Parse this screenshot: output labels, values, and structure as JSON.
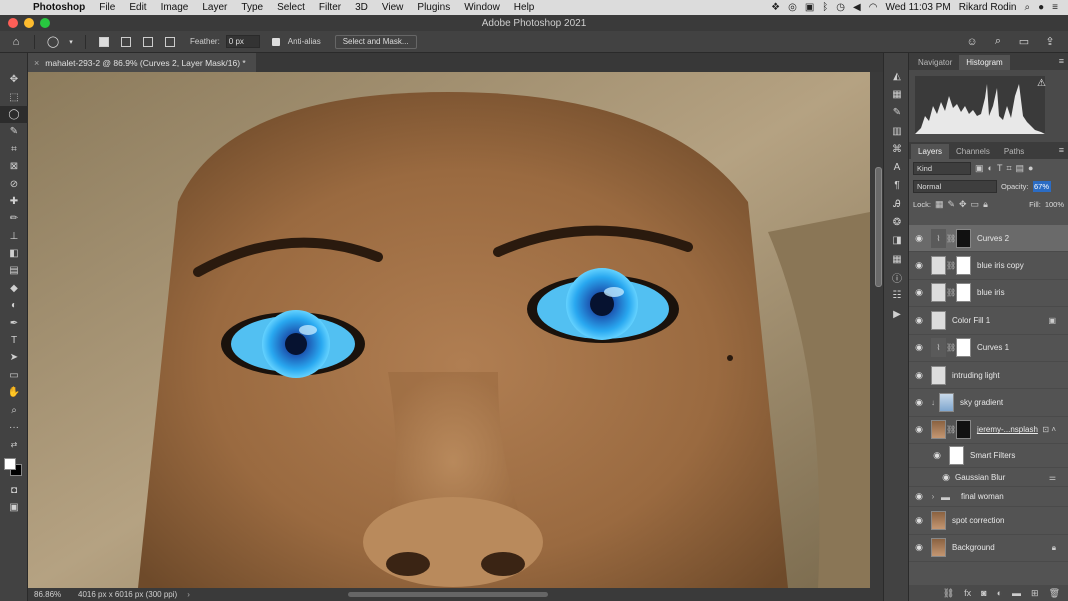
{
  "menubar": {
    "app": "Photoshop",
    "items": [
      "File",
      "Edit",
      "Image",
      "Layer",
      "Type",
      "Select",
      "Filter",
      "3D",
      "View",
      "Plugins",
      "Window",
      "Help"
    ],
    "clock": "Wed 11:03 PM",
    "user": "Rikard Rodin"
  },
  "window": {
    "title": "Adobe Photoshop 2021"
  },
  "options": {
    "feather_label": "Feather:",
    "feather_value": "0 px",
    "antialias_label": "Anti-alias",
    "select_mask_label": "Select and Mask..."
  },
  "document": {
    "tab_title": "mahalet-293-2 @ 86.9% (Curves 2, Layer Mask/16) *",
    "zoom": "86.86%",
    "dimensions": "4016 px x 6016 px (300 ppi)"
  },
  "histogram_panel": {
    "tabs": [
      "Navigator",
      "Histogram"
    ],
    "active_tab": "Histogram"
  },
  "layers_panel": {
    "tabs": [
      "Layers",
      "Channels",
      "Paths"
    ],
    "active_tab": "Layers",
    "filter_kind": "Kind",
    "blend_mode": "Normal",
    "opacity_label": "Opacity:",
    "opacity_value": "67%",
    "lock_label": "Lock:",
    "fill_label": "Fill:",
    "fill_value": "100%",
    "layers": [
      {
        "name": "Curves 2",
        "selected": true
      },
      {
        "name": "blue iris copy"
      },
      {
        "name": "blue iris"
      },
      {
        "name": "Color Fill 1"
      },
      {
        "name": "Curves 1"
      },
      {
        "name": "intruding light"
      },
      {
        "name": "sky gradient"
      },
      {
        "name": "jeremy-...nsplash"
      },
      {
        "name": "Smart Filters"
      },
      {
        "name": "Gaussian Blur"
      },
      {
        "name": "final woman"
      },
      {
        "name": "spot correction"
      },
      {
        "name": "Background"
      }
    ]
  },
  "colors": {
    "accent": "#2b6cc4",
    "iris": "#29a8f0",
    "skin": "#9a6b42"
  }
}
